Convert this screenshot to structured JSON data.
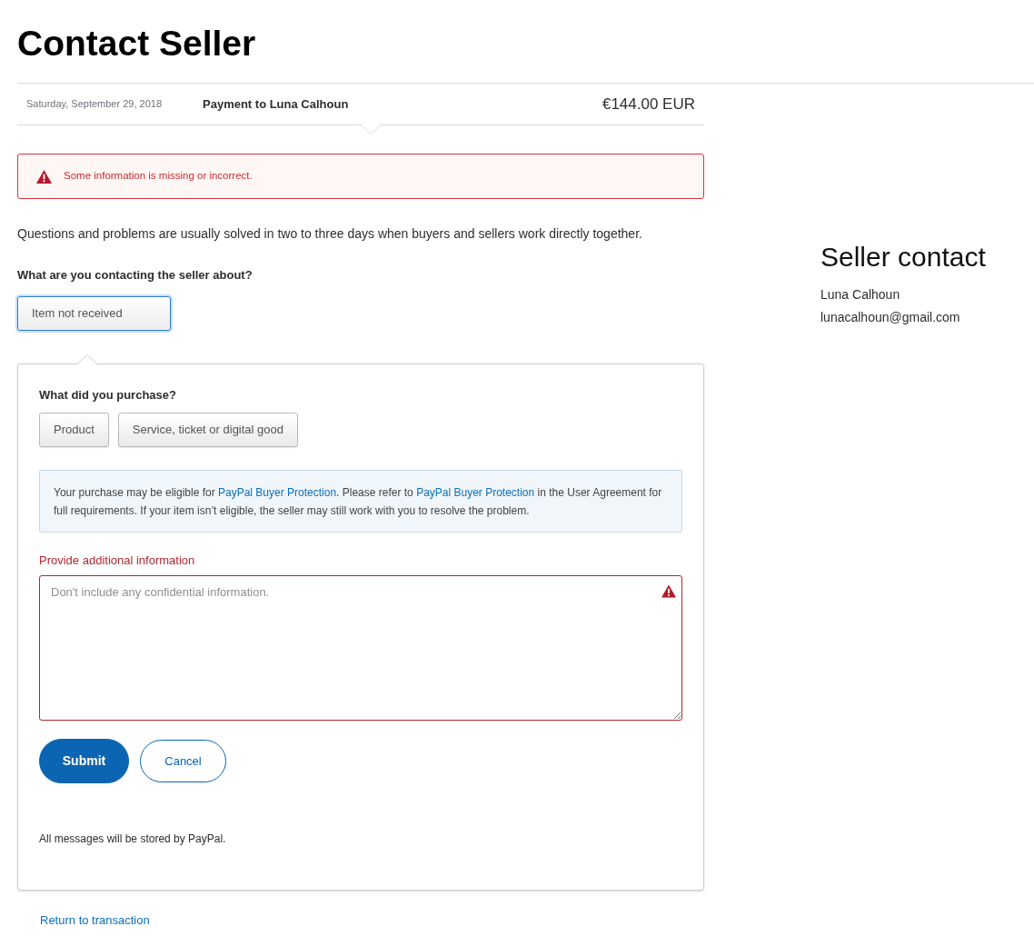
{
  "page": {
    "title": "Contact Seller"
  },
  "transaction": {
    "date": "Saturday, September 29, 2018",
    "description": "Payment to Luna Calhoun",
    "amount": "€144.00 EUR"
  },
  "alert": {
    "kind": "error",
    "text": "Some information is missing or incorrect."
  },
  "intro": "Questions and problems are usually solved in two to three days when buyers and sellers work directly together.",
  "topic": {
    "label": "What are you contacting the seller about?",
    "value": "Item not received",
    "focused": true
  },
  "purchase": {
    "label": "What did you purchase?",
    "options": [
      {
        "label": "Product",
        "selected": false
      },
      {
        "label": "Service, ticket or digital good",
        "selected": false
      }
    ]
  },
  "notice": {
    "parts": [
      {
        "kind": "text",
        "text": "Your purchase may be eligible for "
      },
      {
        "kind": "link",
        "text": "PayPal Buyer Protection"
      },
      {
        "kind": "text",
        "text": ". Please refer to "
      },
      {
        "kind": "link",
        "text": "PayPal Buyer Protection"
      },
      {
        "kind": "text",
        "text": " in the User Agreement for full requirements. If your item isn’t eligible, the seller may still work with you to resolve the problem."
      }
    ]
  },
  "details": {
    "label": "Provide additional information",
    "placeholder": "Don't include any confidential information.",
    "error": true
  },
  "actions": [
    {
      "kind": "primary",
      "label": "Submit"
    },
    {
      "kind": "secondary",
      "label": "Cancel"
    }
  ],
  "footnote": "All messages will be stored by PayPal.",
  "return_link": "Return to transaction",
  "seller": {
    "heading": "Seller contact",
    "name": "Luna Calhoun",
    "email": "lunacalhoun@gmail.com"
  }
}
